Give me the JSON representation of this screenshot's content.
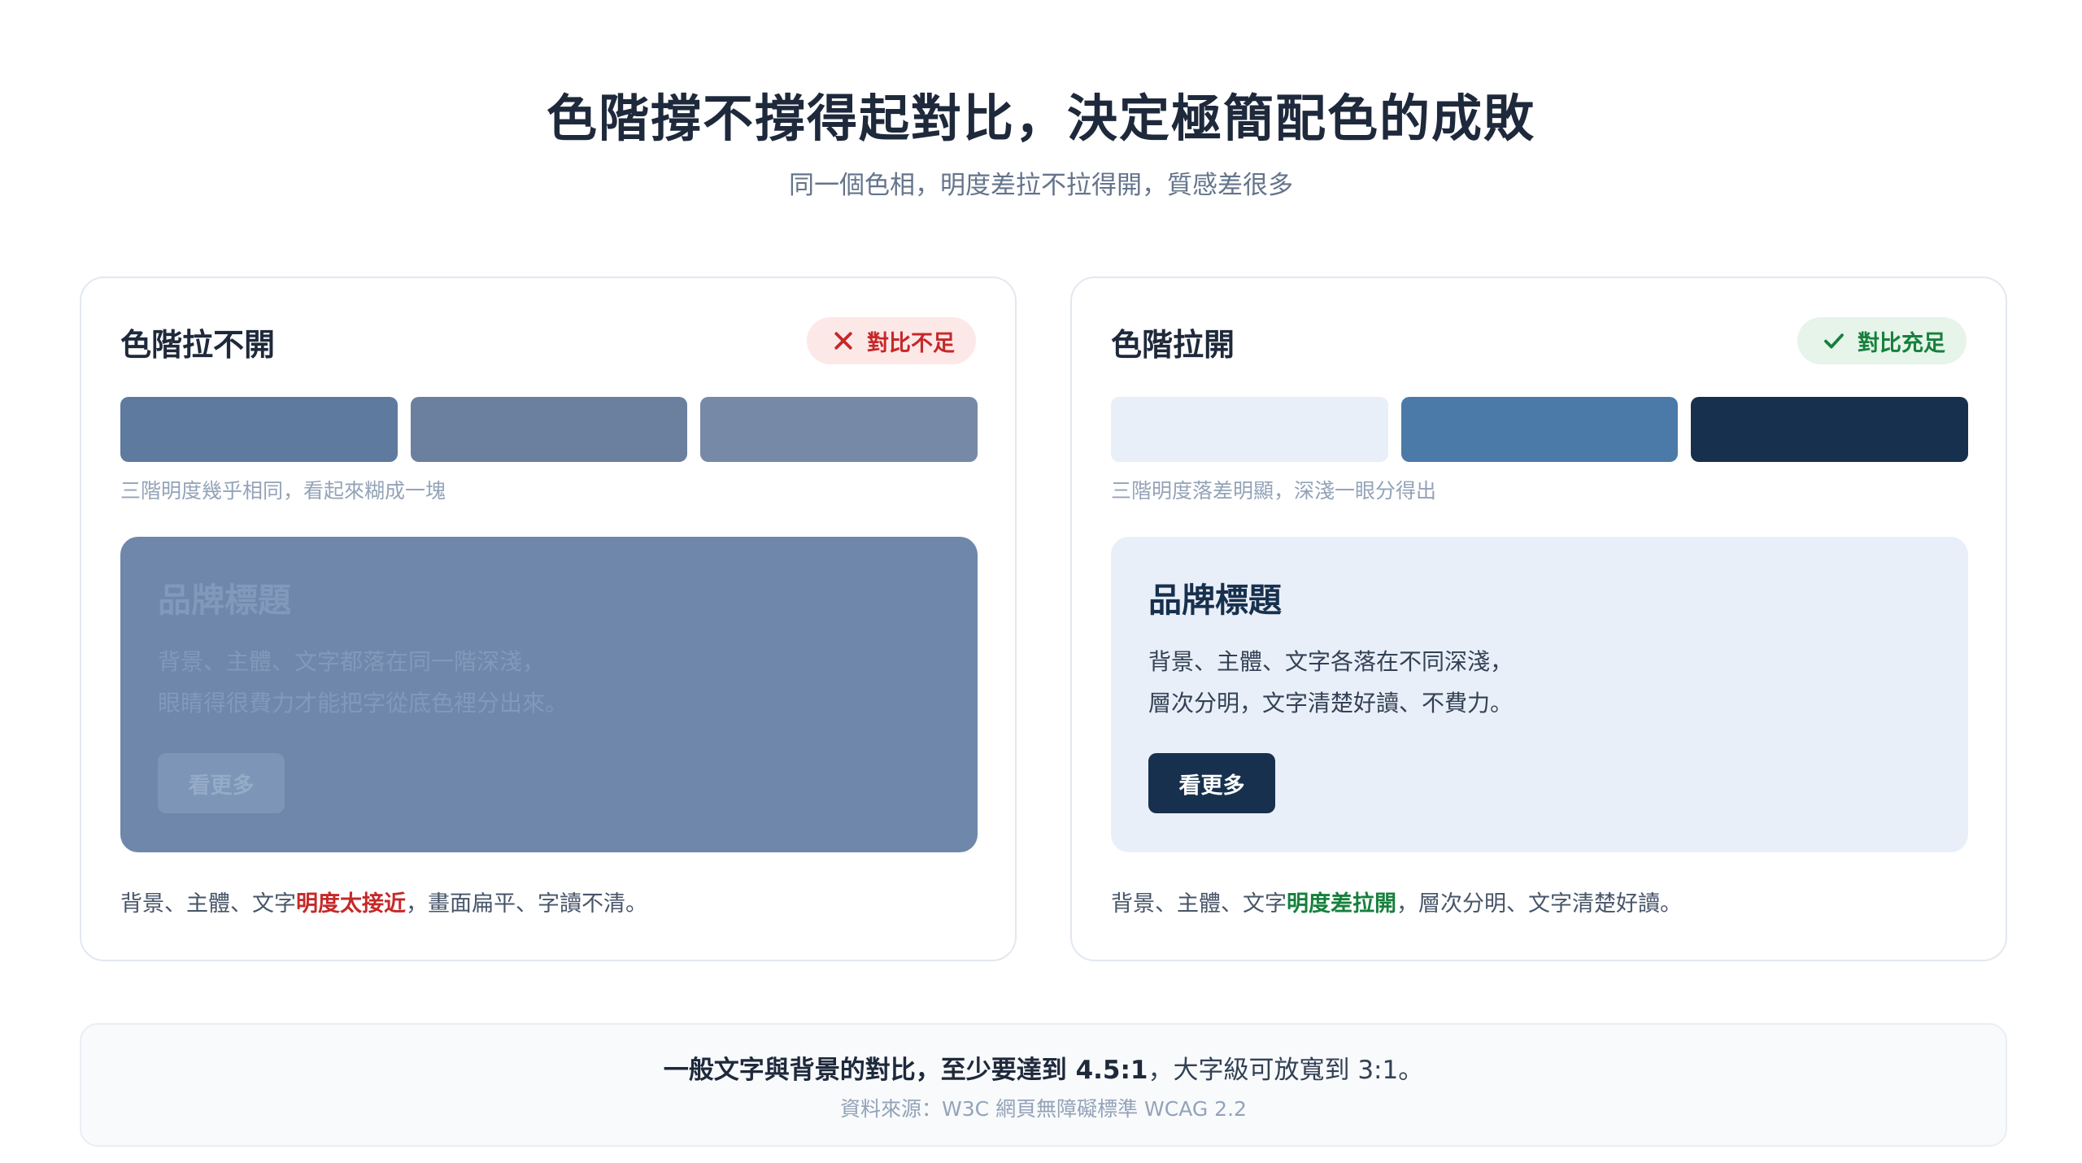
{
  "header": {
    "title": "色階撐不撐得起對比，決定極簡配色的成敗",
    "subtitle": "同一個色相，明度差拉不拉得開，質感差很多"
  },
  "left_card": {
    "title": "色階拉不開",
    "badge": {
      "label": "對比不足",
      "icon": "x-icon",
      "color": "#c62828"
    },
    "swatches": [
      "#5e7a9f",
      "#6b809f",
      "#7689a6"
    ],
    "swatch_caption": "三階明度幾乎相同，看起來糊成一塊",
    "preview": {
      "title": "品牌標題",
      "body_line1": "背景、主體、文字都落在同一階深淺，",
      "body_line2": "眼睛得很費力才能把字從底色裡分出來。",
      "button_label": "看更多",
      "background": "#6e87aa"
    },
    "footer": {
      "prefix": "背景、主體、文字",
      "highlight": "明度太接近",
      "suffix": "，畫面扁平、字讀不清。"
    }
  },
  "right_card": {
    "title": "色階拉開",
    "badge": {
      "label": "對比充足",
      "icon": "check-icon",
      "color": "#16803c"
    },
    "swatches": [
      "#e9eff8",
      "#4b7aa8",
      "#17304e"
    ],
    "swatch_caption": "三階明度落差明顯，深淺一眼分得出",
    "preview": {
      "title": "品牌標題",
      "body_line1": "背景、主體、文字各落在不同深淺，",
      "body_line2": "層次分明，文字清楚好讀、不費力。",
      "button_label": "看更多",
      "background": "#e9eff8"
    },
    "footer": {
      "prefix": "背景、主體、文字",
      "highlight": "明度差拉開",
      "suffix": "，層次分明、文字清楚好讀。"
    }
  },
  "note": {
    "strong": "一般文字與背景的對比，至少要達到 4.5:1",
    "rest": "，大字級可放寬到 3:1。",
    "source": "資料來源：W3C 網頁無障礙標準 WCAG 2.2"
  }
}
